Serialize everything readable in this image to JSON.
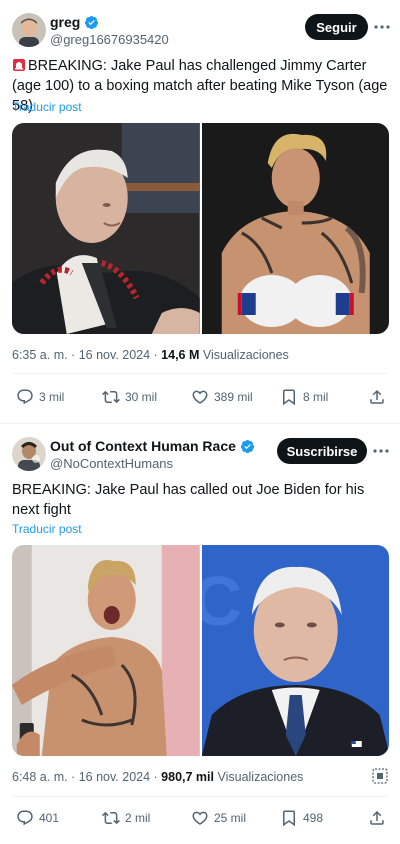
{
  "tweets": [
    {
      "display_name": "greg",
      "handle": "@greg16676935420",
      "follow_label": "Seguir",
      "more_icon": "more-dots-icon",
      "alert_icon": "siren-emoji-icon",
      "text": "BREAKING: Jake Paul has challenged Jimmy Carter (age 100) to a boxing match after beating Mike Tyson (age 58)",
      "translate_label": "Traducir post",
      "time": "6:35 a. m. · 16 nov. 2024 · ",
      "views_count": "14,6 M",
      "views_label": " Visualizaciones",
      "actions": {
        "replies": "3 mil",
        "reposts": "30 mil",
        "likes": "389 mil",
        "bookmarks": "8 mil"
      }
    },
    {
      "display_name": "Out of Context Human Race",
      "handle": "@NoContextHumans",
      "follow_label": "Suscribirse",
      "more_icon": "more-dots-icon",
      "text": "BREAKING: Jake Paul has called out Joe Biden for his next fight",
      "translate_label": "Traducir post",
      "time": "6:48 a. m. · 16 nov. 2024 · ",
      "views_count": "980,7 mil",
      "views_label": " Visualizaciones",
      "actions": {
        "replies": "401",
        "reposts": "2 mil",
        "likes": "25 mil",
        "bookmarks": "498"
      }
    }
  ],
  "colors": {
    "accent": "#1d9bf0",
    "text": "#0f1419",
    "muted": "#536471",
    "button": "#0f1419"
  }
}
